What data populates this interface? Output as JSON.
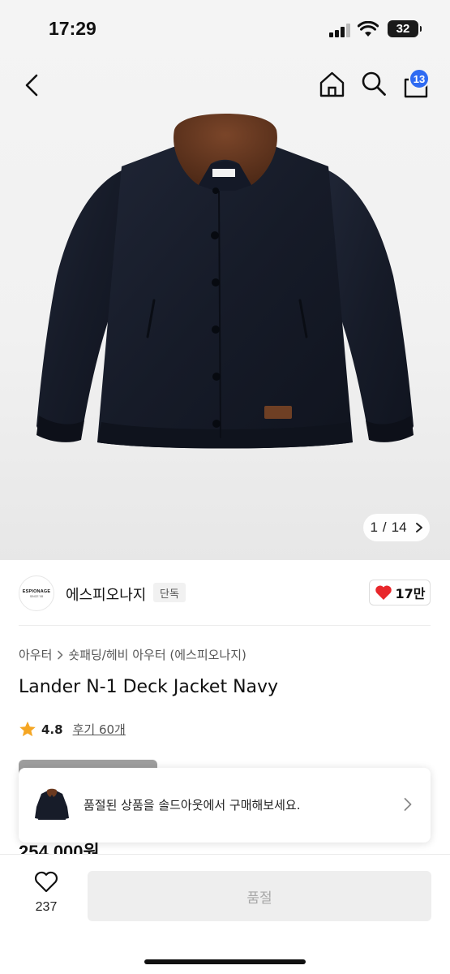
{
  "status_bar": {
    "time": "17:29",
    "battery": "32"
  },
  "header": {
    "cart_count": "13",
    "icons": [
      "back-chevron-icon",
      "home-icon",
      "search-icon",
      "shopping-bag-icon"
    ],
    "badge_color": "#2f6bf2"
  },
  "gallery": {
    "current": "1",
    "separator": "/",
    "total": "14"
  },
  "brand": {
    "logo_line1": "ESPIONAGE",
    "logo_line2": "SINCE '08",
    "name": "에스피오나지",
    "tag": "단독",
    "likes": "17만"
  },
  "product": {
    "breadcrumb": [
      "아우터",
      "숏패딩/헤비 아우터 (에스피오나지)"
    ],
    "title": "Lander N-1 Deck Jacket Navy",
    "rating": "4.8",
    "review_label": "후기 60개",
    "price": "254,000원"
  },
  "soldout_banner": {
    "text": "품절된 상품을 솔드아웃에서 구매해보세요."
  },
  "bottom": {
    "wish_count": "237",
    "buy_label": "품절"
  },
  "colors": {
    "heart": "#e8272b",
    "star": "#f5a623",
    "disabled_button": "#eeeeee"
  }
}
